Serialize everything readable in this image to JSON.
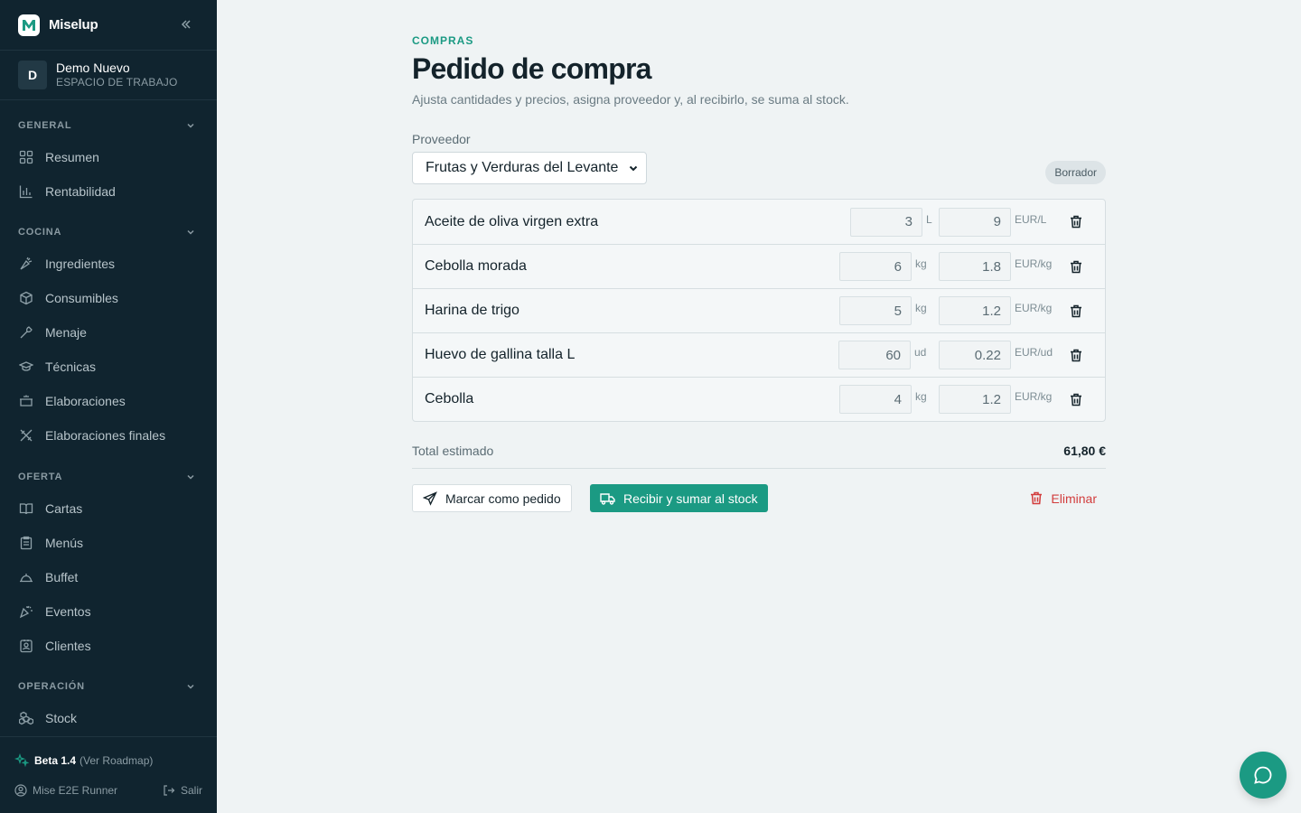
{
  "app": {
    "name": "Miselup",
    "brand_color": "#1b9a83",
    "sidebar_color": "#10242f"
  },
  "workspace": {
    "initial": "D",
    "name": "Demo Nuevo",
    "subtitle": "ESPACIO DE TRABAJO"
  },
  "nav": {
    "general": {
      "label": "GENERAL",
      "items": [
        {
          "label": "Resumen",
          "icon": "grid-icon"
        },
        {
          "label": "Rentabilidad",
          "icon": "bar-chart-icon"
        }
      ]
    },
    "cocina": {
      "label": "COCINA",
      "items": [
        {
          "label": "Ingredientes",
          "icon": "carrot-icon"
        },
        {
          "label": "Consumibles",
          "icon": "box-icon"
        },
        {
          "label": "Menaje",
          "icon": "utensil-icon"
        },
        {
          "label": "Técnicas",
          "icon": "graduation-cap-icon"
        },
        {
          "label": "Elaboraciones",
          "icon": "pot-icon"
        },
        {
          "label": "Elaboraciones finales",
          "icon": "cutlery-icon"
        }
      ]
    },
    "oferta": {
      "label": "OFERTA",
      "items": [
        {
          "label": "Cartas",
          "icon": "book-open-icon"
        },
        {
          "label": "Menús",
          "icon": "clipboard-icon"
        },
        {
          "label": "Buffet",
          "icon": "cloche-icon"
        },
        {
          "label": "Eventos",
          "icon": "party-icon"
        },
        {
          "label": "Clientes",
          "icon": "contact-icon"
        }
      ]
    },
    "operacion": {
      "label": "OPERACIÓN",
      "items": [
        {
          "label": "Stock",
          "icon": "boxes-icon"
        }
      ]
    }
  },
  "footer": {
    "version": "Beta 1.4",
    "roadmap": "(Ver Roadmap)",
    "user": "Mise E2E Runner",
    "logout": "Salir"
  },
  "page": {
    "eyebrow": "COMPRAS",
    "title": "Pedido de compra",
    "description": "Ajusta cantidades y precios, asigna proveedor y, al recibirlo, se suma al stock.",
    "supplier_label": "Proveedor",
    "supplier_value": "Frutas y Verduras del Levante",
    "status": "Borrador",
    "total_label": "Total estimado",
    "total_value": "61,80 €",
    "actions": {
      "mark_ordered": "Marcar como pedido",
      "receive": "Recibir y sumar al stock",
      "delete": "Eliminar"
    },
    "lines": [
      {
        "name": "Aceite de oliva virgen extra",
        "qty": "3",
        "unit": "L",
        "price": "9",
        "price_unit": "EUR/L"
      },
      {
        "name": "Cebolla morada",
        "qty": "6",
        "unit": "kg",
        "price": "1.8",
        "price_unit": "EUR/kg"
      },
      {
        "name": "Harina de trigo",
        "qty": "5",
        "unit": "kg",
        "price": "1.2",
        "price_unit": "EUR/kg"
      },
      {
        "name": "Huevo de gallina talla L",
        "qty": "60",
        "unit": "ud",
        "price": "0.22",
        "price_unit": "EUR/ud"
      },
      {
        "name": "Cebolla",
        "qty": "4",
        "unit": "kg",
        "price": "1.2",
        "price_unit": "EUR/kg"
      }
    ]
  }
}
